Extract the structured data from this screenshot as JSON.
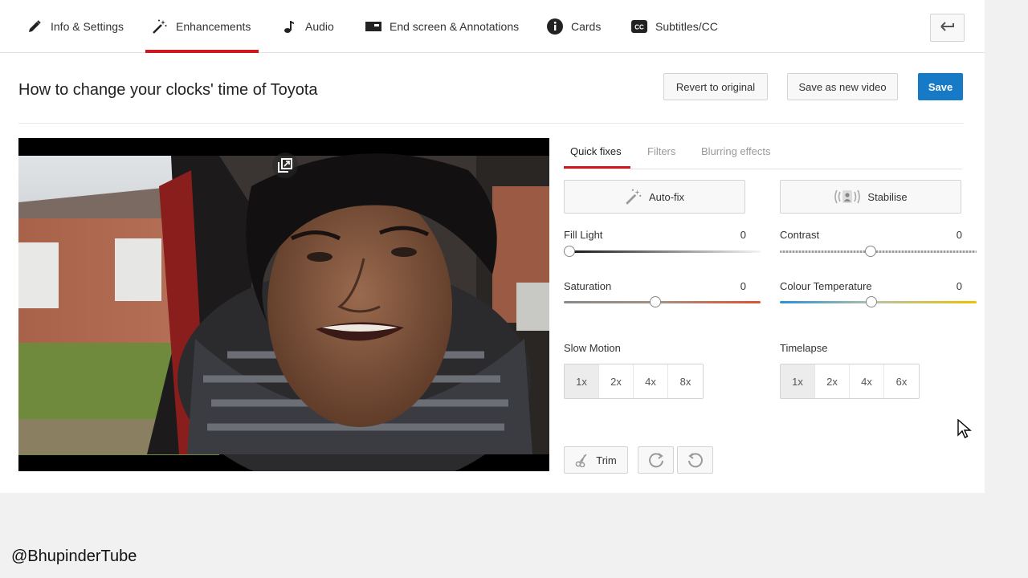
{
  "tabs": [
    {
      "label": "Info & Settings",
      "icon": "pencil-icon"
    },
    {
      "label": "Enhancements",
      "icon": "magic-wand-icon",
      "active": true
    },
    {
      "label": "Audio",
      "icon": "music-note-icon"
    },
    {
      "label": "End screen & Annotations",
      "icon": "end-screen-icon"
    },
    {
      "label": "Cards",
      "icon": "info-icon"
    },
    {
      "label": "Subtitles/CC",
      "icon": "cc-icon"
    }
  ],
  "header": {
    "title": "How to change your clocks' time of Toyota",
    "revert_label": "Revert to original",
    "save_new_label": "Save as new video",
    "save_label": "Save"
  },
  "subtabs": [
    "Quick fixes",
    "Filters",
    "Blurring effects"
  ],
  "quick_fixes": {
    "autofix_label": "Auto-fix",
    "stabilise_label": "Stabilise",
    "fill_light": {
      "label": "Fill Light",
      "value": "0"
    },
    "contrast": {
      "label": "Contrast",
      "value": "0"
    },
    "saturation": {
      "label": "Saturation",
      "value": "0"
    },
    "colour_temperature": {
      "label": "Colour Temperature",
      "value": "0"
    }
  },
  "slow_motion": {
    "label": "Slow Motion",
    "options": [
      "1x",
      "2x",
      "4x",
      "8x"
    ],
    "selected": "1x"
  },
  "timelapse": {
    "label": "Timelapse",
    "options": [
      "1x",
      "2x",
      "4x",
      "6x"
    ],
    "selected": "1x"
  },
  "tools": {
    "trim_label": "Trim"
  },
  "watermark": "@BhupinderTube",
  "colors": {
    "accent_red": "#cc181e",
    "save_blue": "#167ac6"
  }
}
